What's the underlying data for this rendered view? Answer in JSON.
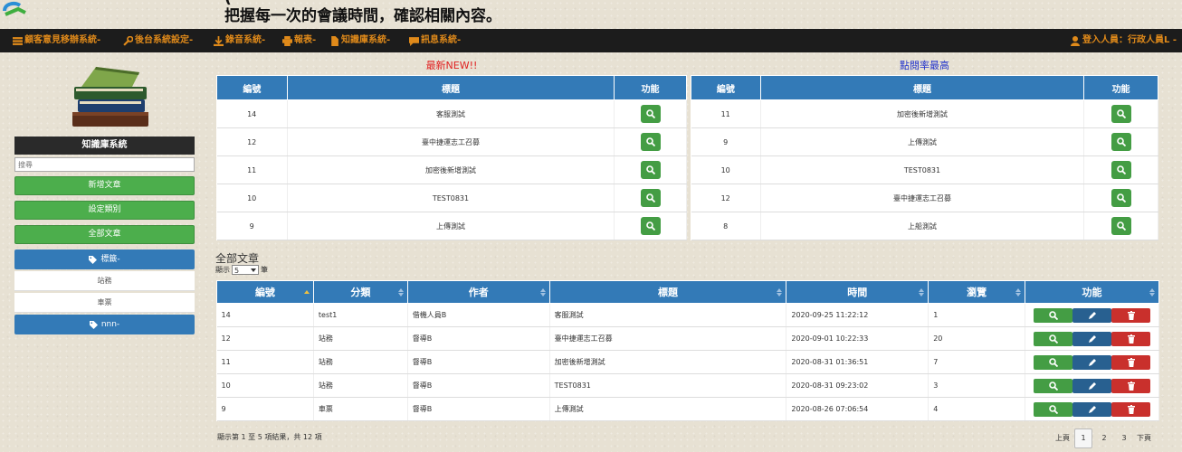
{
  "banner": {
    "line1": "(",
    "line2": "把握每一次的會議時間，確認相關內容。"
  },
  "nav": {
    "items": [
      "顧客意見移辦系統-",
      "後台系統設定-",
      "錄音系統-",
      "報表-",
      "知識庫系統-",
      "訊息系統-"
    ],
    "user": "登入人員：行政人員L -"
  },
  "sidebar": {
    "title": "知識庫系統",
    "search_placeholder": "搜尋",
    "buttons": [
      "新增文章",
      "設定類別",
      "全部文章"
    ],
    "cat1": "標籤-",
    "subs": [
      "站務",
      "車票"
    ],
    "cat2": "nnn-"
  },
  "newest": {
    "title": "最新NEW!!",
    "headers": [
      "編號",
      "標題",
      "功能"
    ],
    "rows": [
      {
        "id": "14",
        "title": "客服測試"
      },
      {
        "id": "12",
        "title": "臺中捷運志工召募"
      },
      {
        "id": "11",
        "title": "加密後新增測試"
      },
      {
        "id": "10",
        "title": "TEST0831"
      },
      {
        "id": "9",
        "title": "上傳測試"
      }
    ]
  },
  "popular": {
    "title": "點閱率最高",
    "headers": [
      "編號",
      "標題",
      "功能"
    ],
    "rows": [
      {
        "id": "11",
        "title": "加密後新增測試"
      },
      {
        "id": "9",
        "title": "上傳測試"
      },
      {
        "id": "10",
        "title": "TEST0831"
      },
      {
        "id": "12",
        "title": "臺中捷運志工召募"
      },
      {
        "id": "8",
        "title": "上船測試"
      }
    ]
  },
  "all": {
    "title": "全部文章",
    "show_prefix": "顯示",
    "show_value": "5",
    "show_suffix": "筆",
    "headers": [
      "編號",
      "分類",
      "作者",
      "標題",
      "時間",
      "瀏覽",
      "功能"
    ],
    "rows": [
      {
        "id": "14",
        "cat": "test1",
        "author": "借機人員B",
        "title": "客服測試",
        "time": "2020-09-25 11:22:12",
        "views": "1"
      },
      {
        "id": "12",
        "cat": "站務",
        "author": "督導B",
        "title": "臺中捷運志工召募",
        "time": "2020-09-01 10:22:33",
        "views": "20"
      },
      {
        "id": "11",
        "cat": "站務",
        "author": "督導B",
        "title": "加密後新增測試",
        "time": "2020-08-31 01:36:51",
        "views": "7"
      },
      {
        "id": "10",
        "cat": "站務",
        "author": "督導B",
        "title": "TEST0831",
        "time": "2020-08-31 09:23:02",
        "views": "3"
      },
      {
        "id": "9",
        "cat": "車票",
        "author": "督導B",
        "title": "上傳測試",
        "time": "2020-08-26 07:06:54",
        "views": "4"
      }
    ],
    "footer": "顯示第 1 至 5 項結果，共 12 項",
    "pager": {
      "prev": "上頁",
      "pages": [
        "1",
        "2",
        "3"
      ],
      "next": "下頁"
    }
  },
  "colors": {
    "primary": "#337ab7",
    "success": "#449d44",
    "danger": "#c9302c",
    "nav_text": "#e08a1a",
    "new_title": "#e02020",
    "popular_title": "#2233cc"
  }
}
